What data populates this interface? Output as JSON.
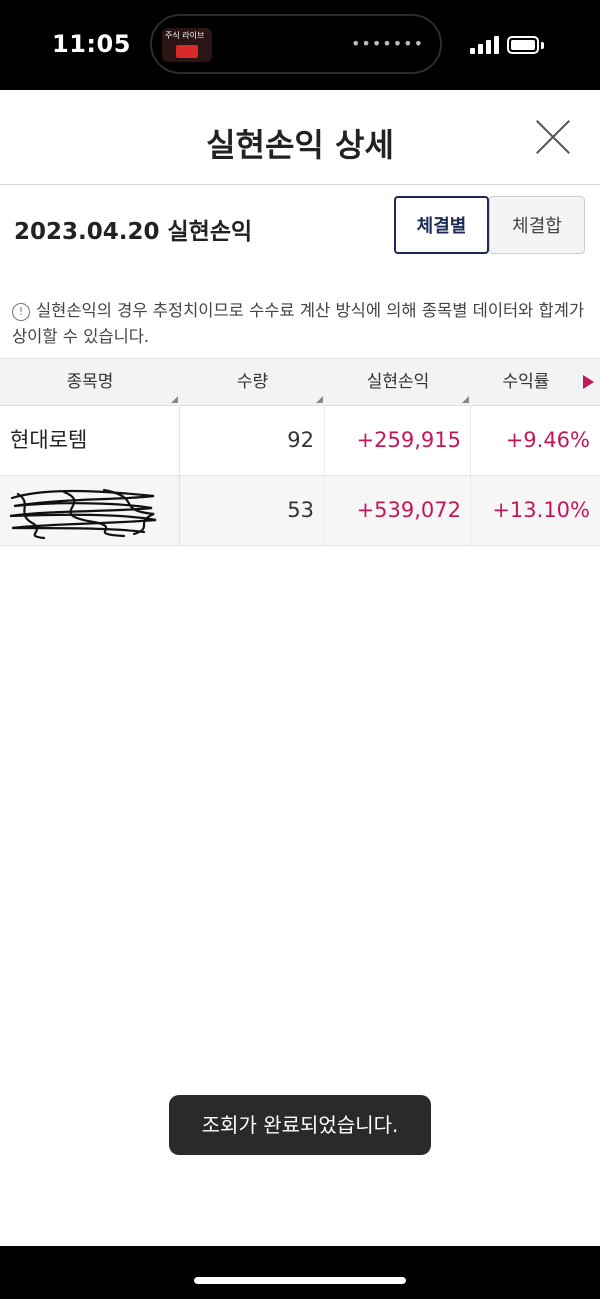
{
  "status_bar": {
    "time": "11:05",
    "live_activity_text": "주식 라이브",
    "island_dots": "•••••••"
  },
  "header": {
    "title": "실현손익 상세",
    "close_icon": "close-icon"
  },
  "date_row": {
    "label": "2023.04.20 실현손익",
    "toggle": [
      {
        "label": "체결별",
        "active": true
      },
      {
        "label": "체결합",
        "active": false
      }
    ]
  },
  "notice": {
    "icon": "info-icon",
    "text": "실현손익의 경우 추정치이므로 수수료 계산 방식에 의해 종목별 데이터와 합계가 상이할 수 있습니다."
  },
  "table": {
    "columns": [
      "종목명",
      "수량",
      "실현손익",
      "수익률"
    ],
    "rows": [
      {
        "name": "현대로템",
        "qty": "92",
        "pl": "+259,915",
        "rate": "+9.46%"
      },
      {
        "name": "",
        "qty": "53",
        "pl": "+539,072",
        "rate": "+13.10%"
      }
    ]
  },
  "toast": {
    "text": "조회가 완료되었습니다."
  },
  "colors": {
    "accent_profit": "#c2185b",
    "active_toggle": "#1c2a55"
  }
}
